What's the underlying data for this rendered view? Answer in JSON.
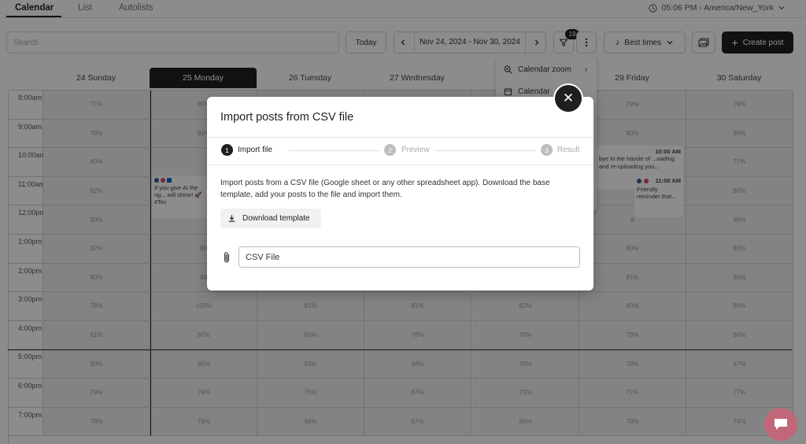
{
  "tabs": [
    "Calendar",
    "List",
    "Autolists"
  ],
  "timezone": "05:06 PM - America/New_York",
  "toolbar": {
    "search_placeholder": "Search",
    "today": "Today",
    "date_range": "Nov 24, 2024 - Nov 30, 2024",
    "filter_badge": "19",
    "best_times": "Best times",
    "create_post": "Create post"
  },
  "days": [
    "24 Sunday",
    "25 Monday",
    "26 Tuesday",
    "27 Wednesday",
    "28 Thursday",
    "29 Friday",
    "30 Saturday"
  ],
  "times": [
    "8:00am",
    "9:00am",
    "10:00am",
    "11:00am",
    "12:00pm",
    "1:00pm",
    "2:00pm",
    "3:00pm",
    "4:00pm",
    "5:00pm",
    "6:00pm",
    "7:00pm"
  ],
  "percentages": [
    [
      "77%",
      "80%",
      "",
      "",
      "",
      "79%",
      "79%"
    ],
    [
      "79%",
      "80%",
      "",
      "",
      "",
      "80%",
      "80%"
    ],
    [
      "80%",
      "",
      "",
      "",
      "",
      "",
      "77%"
    ],
    [
      "82%",
      "",
      "",
      "",
      "",
      "",
      "80%"
    ],
    [
      "80%",
      "",
      "",
      "",
      "",
      "8",
      "80%"
    ],
    [
      "82%",
      "80",
      "",
      "",
      "",
      "80%",
      "82%"
    ],
    [
      "80%",
      "80",
      "",
      "",
      "",
      "81%",
      "80%"
    ],
    [
      "78%",
      "100%",
      "81%",
      "81%",
      "82%",
      "80%",
      "80%"
    ],
    [
      "81%",
      "80%",
      "80%",
      "78%",
      "78%",
      "79%",
      "68%"
    ],
    [
      "80%",
      "85%",
      "83%",
      "68%",
      "70%",
      "78%",
      "67%"
    ],
    [
      "79%",
      "79%",
      "76%",
      "67%",
      "73%",
      "77%",
      "77%"
    ],
    [
      "78%",
      "76%",
      "66%",
      "67%",
      "65%",
      "79%",
      "74%"
    ]
  ],
  "menu": {
    "zoom": "Calendar zoom",
    "second": "Calendar"
  },
  "posts": {
    "monday_text": "If you give AI the rig... will shine! 🚀 #Tec",
    "friday_time": "10:00 AM",
    "friday_text": "bye to the hassle of ...oading and re-uploading you...",
    "friday2_time": "11:00 AM",
    "friday2_text": "Friendly reminder that..."
  },
  "modal": {
    "title": "Import posts from CSV file",
    "steps": [
      {
        "num": "1",
        "label": "Import file"
      },
      {
        "num": "2",
        "label": "Preview"
      },
      {
        "num": "3",
        "label": "Result"
      }
    ],
    "description": "Import posts from a CSV file (Google sheet or any other spreadsheet app). Download the base template, add your posts to the file and import them.",
    "download_label": "Download template",
    "csv_label": "CSV File"
  },
  "colors": {
    "dark": "#1f1f1f",
    "chat": "#c2677a"
  }
}
